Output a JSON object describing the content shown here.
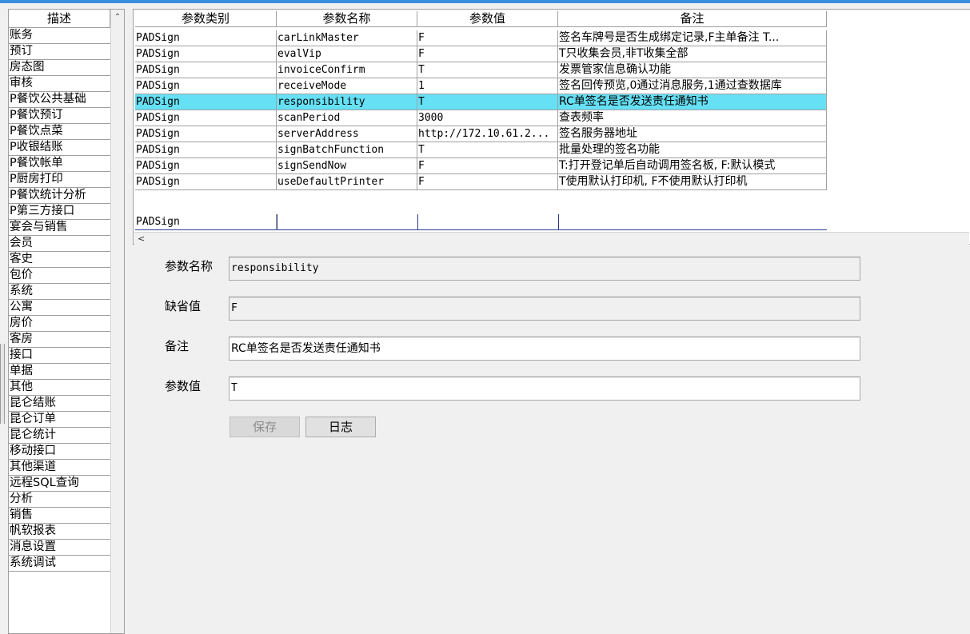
{
  "left_panel": {
    "header": "描述",
    "items": [
      "账务",
      "预订",
      "房态图",
      "审核",
      "P餐饮公共基础",
      "P餐饮预订",
      "P餐饮点菜",
      "P收银结账",
      "P餐饮帐单",
      "P厨房打印",
      "P餐饮统计分析",
      "P第三方接口",
      "宴会与销售",
      "会员",
      "客史",
      "包价",
      "系统",
      "公寓",
      "房价",
      "客房",
      "接口",
      "单据",
      "其他",
      "昆仑结账",
      "昆仑订单",
      "昆仑统计",
      "移动接口",
      "其他渠道",
      "远程SQL查询",
      "分析",
      "销售",
      "帆软报表",
      "消息设置",
      "系统调试"
    ]
  },
  "grid": {
    "columns": [
      "参数类别",
      "参数名称",
      "参数值",
      "备注"
    ],
    "rows": [
      [
        "PADSign",
        "carLinkMaster",
        "F",
        "签名车牌号是否生成绑定记录,F主单备注 T..."
      ],
      [
        "PADSign",
        "evalVip",
        "F",
        "T只收集会员,非T收集全部"
      ],
      [
        "PADSign",
        "invoiceConfirm",
        "T",
        "发票管家信息确认功能"
      ],
      [
        "PADSign",
        "receiveMode",
        "1",
        "签名回传预览,0通过消息服务,1通过查数据库"
      ],
      [
        "PADSign",
        "responsibility",
        "T",
        "RC单签名是否发送责任通知书"
      ],
      [
        "PADSign",
        "scanPeriod",
        "3000",
        "查表频率"
      ],
      [
        "PADSign",
        "serverAddress",
        "http://172.10.61.2...",
        "签名服务器地址"
      ],
      [
        "PADSign",
        "signBatchFunction",
        "T",
        "批量处理的签名功能"
      ],
      [
        "PADSign",
        "signSendNow",
        "F",
        "T:打开登记单后自动调用签名板, F:默认模式"
      ],
      [
        "PADSign",
        "useDefaultPrinter",
        "F",
        "T使用默认打印机, F不使用默认打印机"
      ]
    ],
    "new_row": [
      "PADSign",
      "",
      "",
      ""
    ],
    "selected_index": 4
  },
  "form": {
    "name_label": "参数名称",
    "name_value": "responsibility",
    "default_label": "缺省值",
    "default_value": "F",
    "note_label": "备注",
    "note_value": "RC单签名是否发送责任通知书",
    "value_label": "参数值",
    "value_value": "T",
    "save_label": "保存",
    "log_label": "日志"
  },
  "icons": {
    "scroll_up": "chevron-up-icon",
    "scroll_left": "chevron-left-icon"
  }
}
